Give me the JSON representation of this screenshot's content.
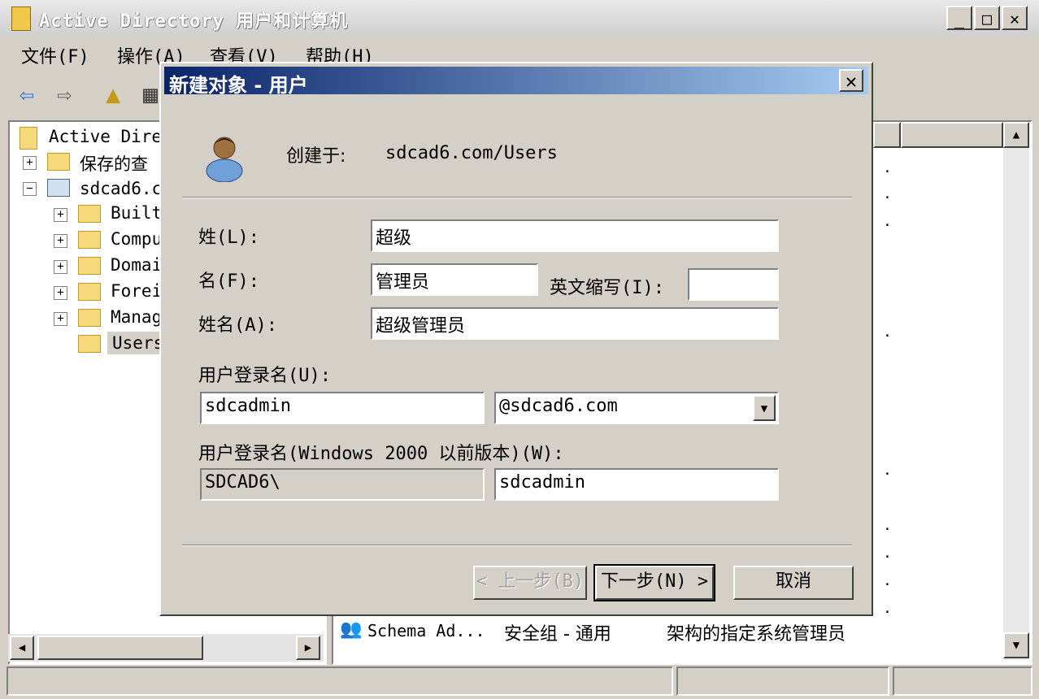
{
  "window": {
    "title": "Active Directory 用户和计算机"
  },
  "menu": [
    "文件(F)",
    "操作(A)",
    "查看(V)",
    "帮助(H)"
  ],
  "tree": {
    "root": "Active Dire",
    "saved": "保存的查",
    "domain": "sdcad6.c",
    "children": [
      "Built",
      "Compu",
      "Domai",
      "Forei",
      "Manag",
      "Users"
    ]
  },
  "list": {
    "row": {
      "name": "Schema Ad...",
      "type": "安全组 - 通用",
      "desc": "架构的指定系统管理员"
    }
  },
  "dialog": {
    "title": "新建对象 - 用户",
    "created_in_label": "创建于:",
    "created_in_value": "sdcad6.com/Users",
    "last_name_label": "姓(L):",
    "last_name_value": "超级",
    "first_name_label": "名(F):",
    "first_name_value": "管理员",
    "initials_label": "英文缩写(I):",
    "initials_value": "",
    "full_name_label": "姓名(A):",
    "full_name_value": "超级管理员",
    "logon_label": "用户登录名(U):",
    "logon_value": "sdcadmin",
    "upn_suffix": "@sdcad6.com",
    "prewin_label": "用户登录名(Windows 2000 以前版本)(W):",
    "prewin_domain": "SDCAD6\\",
    "prewin_value": "sdcadmin",
    "back_button": "< 上一步(B)",
    "next_button": "下一步(N) >",
    "cancel_button": "取消"
  }
}
